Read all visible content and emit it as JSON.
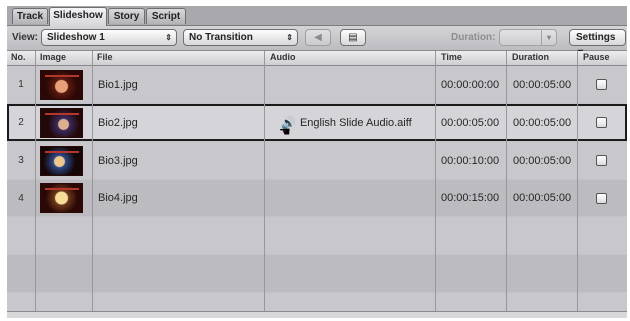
{
  "tabs": [
    {
      "label": "Track",
      "active": false
    },
    {
      "label": "Slideshow",
      "active": true
    },
    {
      "label": "Story",
      "active": false
    },
    {
      "label": "Script",
      "active": false
    }
  ],
  "toolbar": {
    "view_label": "View:",
    "view_value": "Slideshow 1",
    "transition_value": "No Transition",
    "duration_label": "Duration:",
    "duration_value": "",
    "settings_label": "Settings",
    "settings_arrow": "▾",
    "updown_glyph": "⇕",
    "preview_icon": "◀",
    "apply_icon": "▤"
  },
  "columns": {
    "no": "No.",
    "image": "Image",
    "file": "File",
    "audio": "Audio",
    "time": "Time",
    "duration": "Duration",
    "pause": "Pause"
  },
  "rows": [
    {
      "no": "1",
      "file": "Bio1.jpg",
      "audio": "",
      "time": "00:00:00:00",
      "duration": "00:00:05:00"
    },
    {
      "no": "2",
      "file": "Bio2.jpg",
      "audio": "English Slide Audio.aiff",
      "audio_icon": "speaker-icon",
      "time": "00:00:05:00",
      "duration": "00:00:05:00"
    },
    {
      "no": "3",
      "file": "Bio3.jpg",
      "audio": "",
      "time": "00:00:10:00",
      "duration": "00:00:05:00"
    },
    {
      "no": "4",
      "file": "Bio4.jpg",
      "audio": "",
      "time": "00:00:15:00",
      "duration": "00:00:05:00"
    }
  ],
  "glyphs": {
    "speaker": "🔊",
    "cursor": "☚"
  }
}
